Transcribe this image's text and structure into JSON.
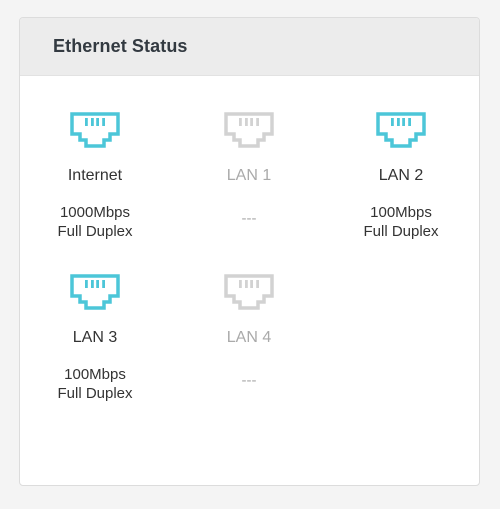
{
  "panel": {
    "title": "Ethernet Status"
  },
  "colors": {
    "active_icon": "#4cc6d8",
    "inactive_icon": "#d2d2d2",
    "header_bg": "#ececec"
  },
  "ports": [
    {
      "label": "Internet",
      "state": "connected",
      "speed": "1000Mbps",
      "duplex": "Full Duplex",
      "icon": "ethernet-port-icon"
    },
    {
      "label": "LAN 1",
      "state": "disconnected",
      "status": "---",
      "icon": "ethernet-port-icon"
    },
    {
      "label": "LAN 2",
      "state": "connected",
      "speed": "100Mbps",
      "duplex": "Full Duplex",
      "icon": "ethernet-port-icon"
    },
    {
      "label": "LAN 3",
      "state": "connected",
      "speed": "100Mbps",
      "duplex": "Full Duplex",
      "icon": "ethernet-port-icon"
    },
    {
      "label": "LAN 4",
      "state": "disconnected",
      "status": "---",
      "icon": "ethernet-port-icon"
    }
  ]
}
